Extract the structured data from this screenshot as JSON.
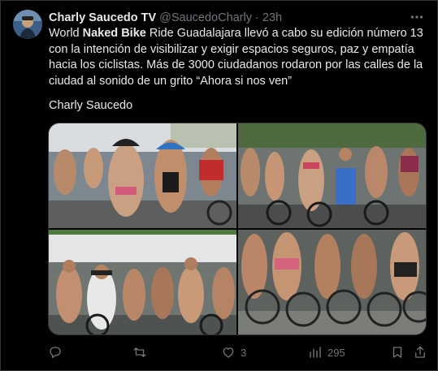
{
  "tweet": {
    "author_name": "Charly Saucedo TV",
    "handle": "@SaucedoCharly",
    "separator": "·",
    "time": "23h",
    "text_prefix": "World ",
    "text_bold": "Naked Bike",
    "text_rest": " Ride Guadalajara llevó a cabo su edición número 13 con la intención de visibilizar y exigir espacios seguros, paz y empatía hacia los ciclistas. Más de 3000 ciudadanos rodaron por las calles de la ciudad al sonido de un grito “Ahora si nos ven”",
    "signature": "Charly Saucedo"
  },
  "actions": {
    "reply_count": "",
    "retweet_count": "",
    "like_count": "3",
    "views_count": "295"
  },
  "icons": {
    "more": "more-icon",
    "reply": "reply-icon",
    "retweet": "retweet-icon",
    "like": "heart-icon",
    "views": "views-icon",
    "bookmark": "bookmark-icon",
    "share": "share-icon"
  },
  "colors": {
    "background": "#000000",
    "text": "#e7e9ea",
    "muted": "#71767b",
    "border": "#2f3336"
  }
}
